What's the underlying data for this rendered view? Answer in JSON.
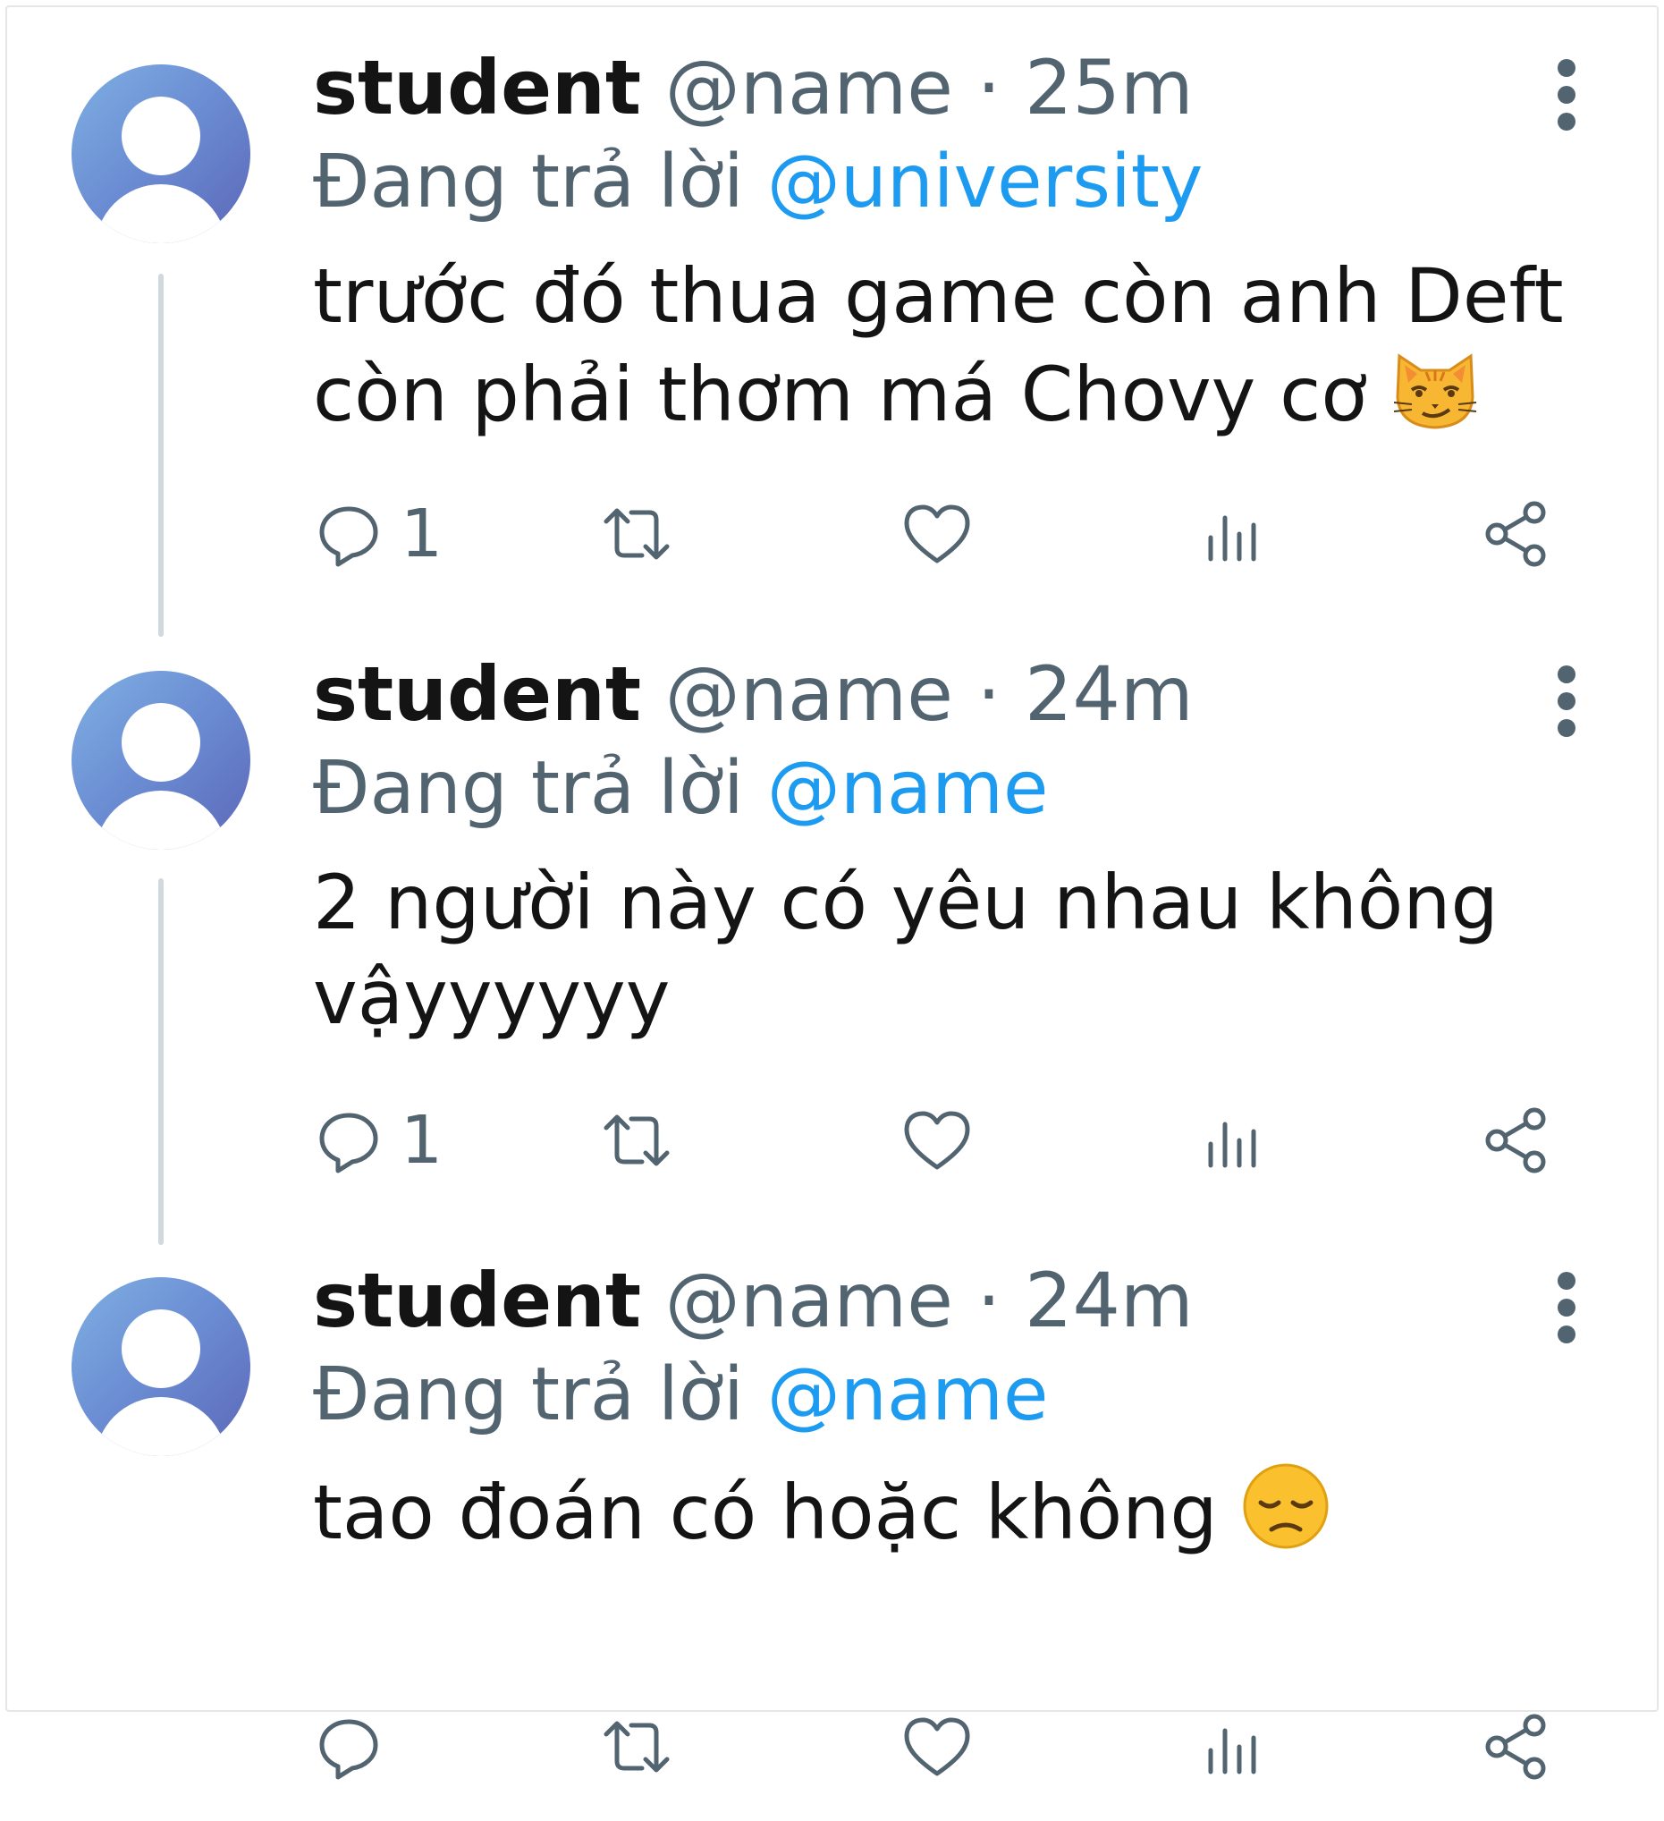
{
  "tweets": [
    {
      "username": "student",
      "handle": "@name",
      "separator": " · ",
      "time": "25m",
      "replying_prefix": "Đang trả lời ",
      "replying_to": "@university",
      "text_line1": "trước đó thua game còn anh Deft",
      "text_line2": "còn phải thơm má Chovy cơ",
      "emoji": "smirking-cat-emoji",
      "reply_count": "1"
    },
    {
      "username": "student",
      "handle": "@name",
      "separator": " · ",
      "time": "24m",
      "replying_prefix": "Đang trả lời ",
      "replying_to": "@name",
      "text_line1": "2 người này có yêu nhau không",
      "text_line2": "vậyyyyyy",
      "reply_count": "1"
    },
    {
      "username": "student",
      "handle": "@name",
      "separator": " · ",
      "time": "24m",
      "replying_prefix": "Đang trả lời ",
      "replying_to": "@name",
      "text_line1": "tao đoán có hoặc không",
      "emoji": "disappointed-face-emoji",
      "reply_count": ""
    }
  ],
  "icons": [
    "reply-icon",
    "retweet-icon",
    "like-icon",
    "views-icon",
    "share-icon",
    "more-icon"
  ],
  "colors": {
    "mention": "#1d9bf0",
    "muted": "#536471",
    "text": "#141414",
    "avatar": "#6a8bd2"
  }
}
